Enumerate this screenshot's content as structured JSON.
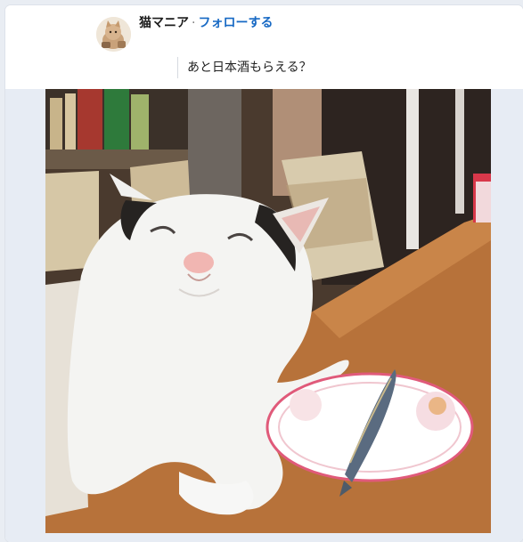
{
  "post": {
    "author_name": "猫マニア",
    "separator": "·",
    "follow_label": "フォローする",
    "text": "あと日本酒もらえる？"
  },
  "photo": {
    "subject_icon": "cat-photo"
  },
  "colors": {
    "follow_blue": "#1769c4",
    "card_bg": "#ffffff",
    "page_bg": "#e9edf3"
  }
}
